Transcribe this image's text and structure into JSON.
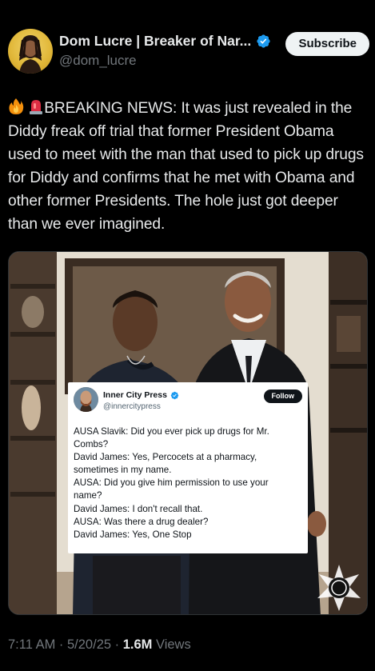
{
  "author": {
    "display_name": "Dom Lucre | Breaker of Nar...",
    "handle": "@dom_lucre",
    "verified": true
  },
  "subscribe_label": "Subscribe",
  "tweet": {
    "emojis": [
      "fire-emoji",
      "siren-emoji"
    ],
    "text": "BREAKING NEWS: It was just revealed in the Diddy freak off trial that former President Obama used to meet with the man that used to pick up drugs for Diddy and confirms that he met with Obama and other former Presidents. The hole just got deeper than we ever imagined."
  },
  "quote": {
    "name": "Inner City Press",
    "handle": "@innercitypress",
    "verified": true,
    "follow_label": "Follow",
    "lines": [
      "AUSA Slavik: Did you ever pick up drugs for Mr.",
      "Combs?",
      "David James: Yes, Percocets at a pharmacy,",
      "sometimes in my name.",
      "AUSA: Did you give him permission to use your",
      "name?",
      "David James: I don't recall that.",
      "AUSA: Was there a drug dealer?",
      "David James: Yes, One Stop"
    ]
  },
  "meta": {
    "time": "7:11 AM",
    "sep1": " · ",
    "date": "5/20/25",
    "sep2": " · ",
    "views_count": "1.6M",
    "views_label": " Views"
  },
  "colors": {
    "background": "#000000",
    "text": "#e7e9ea",
    "secondary_text": "#71767b",
    "verified_blue": "#1d9bf0"
  }
}
